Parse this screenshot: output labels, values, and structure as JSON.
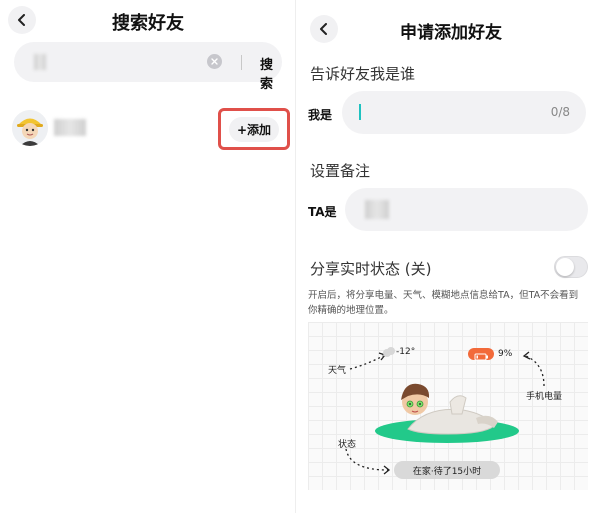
{
  "left": {
    "title": "搜索好友",
    "search": {
      "button_label": "搜索"
    },
    "result": {
      "add_label": "+添加"
    }
  },
  "right": {
    "title": "申请添加好友",
    "intro_section": {
      "heading": "告诉好友我是谁",
      "row_label": "我是",
      "counter": "0/8"
    },
    "remark_section": {
      "heading": "设置备注",
      "row_label": "TA是"
    },
    "share_section": {
      "heading": "分享实时状态 (关)",
      "toggle_on": false,
      "description": "开启后，将分享电量、天气、模糊地点信息给TA，但TA不会看到你精确的地理位置。",
      "illustration": {
        "weather_label": "天气",
        "temperature": "-12°",
        "battery_percent": "9%",
        "battery_label": "手机电量",
        "status_label": "状态",
        "status_value": "在家·待了15小时"
      }
    }
  },
  "colors": {
    "highlight_border": "#e0504a",
    "cursor": "#1fc2c0",
    "battery": "#f26a3a",
    "platform": "#22c98a"
  }
}
